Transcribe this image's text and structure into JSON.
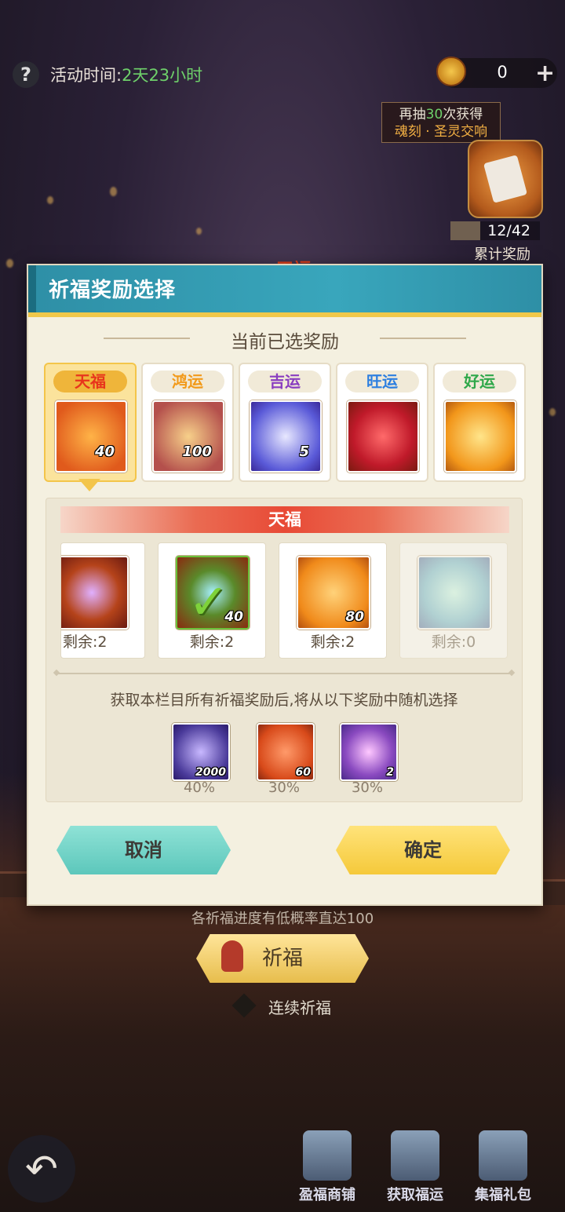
{
  "top_bar": {
    "event_label": "活动时间:",
    "event_time": "2天23小时",
    "currency_value": "0"
  },
  "cumulative": {
    "tip_prefix": "再抽",
    "tip_count": "30",
    "tip_suffix": "次获得",
    "tip_reward": "魂刻 · 圣灵交响",
    "progress": "12/42",
    "label": "累计奖励"
  },
  "background": {
    "tier_title": "天福",
    "hint": "各祈福进度有低概率直达100",
    "pray_label": "祈福",
    "continuous_label": "连续祈福"
  },
  "modal": {
    "title": "祈福奖励选择",
    "section_title": "当前已选奖励",
    "tiers": [
      {
        "name": "天福",
        "count": "40",
        "color": "#e8341c"
      },
      {
        "name": "鸿运",
        "count": "100",
        "color": "#f29a1a"
      },
      {
        "name": "吉运",
        "count": "5",
        "color": "#8a3ec0"
      },
      {
        "name": "旺运",
        "count": "",
        "color": "#2d7fe0"
      },
      {
        "name": "好运",
        "count": "",
        "color": "#2fa84a"
      }
    ],
    "panel_title": "天福",
    "items": [
      {
        "remain": "剩余:2",
        "count": ""
      },
      {
        "remain": "剩余:2",
        "count": "40"
      },
      {
        "remain": "剩余:2",
        "count": "80"
      },
      {
        "remain": "剩余:0",
        "count": ""
      }
    ],
    "random_text": "获取本栏目所有祈福奖励后,将从以下奖励中随机选择",
    "bonus": [
      {
        "count": "2000",
        "pct": "40%"
      },
      {
        "count": "60",
        "pct": "30%"
      },
      {
        "count": "2",
        "pct": "30%"
      }
    ],
    "cancel_label": "取消",
    "confirm_label": "确定"
  },
  "bottom_nav": [
    {
      "label": "盈福商铺"
    },
    {
      "label": "获取福运"
    },
    {
      "label": "集福礼包"
    }
  ]
}
